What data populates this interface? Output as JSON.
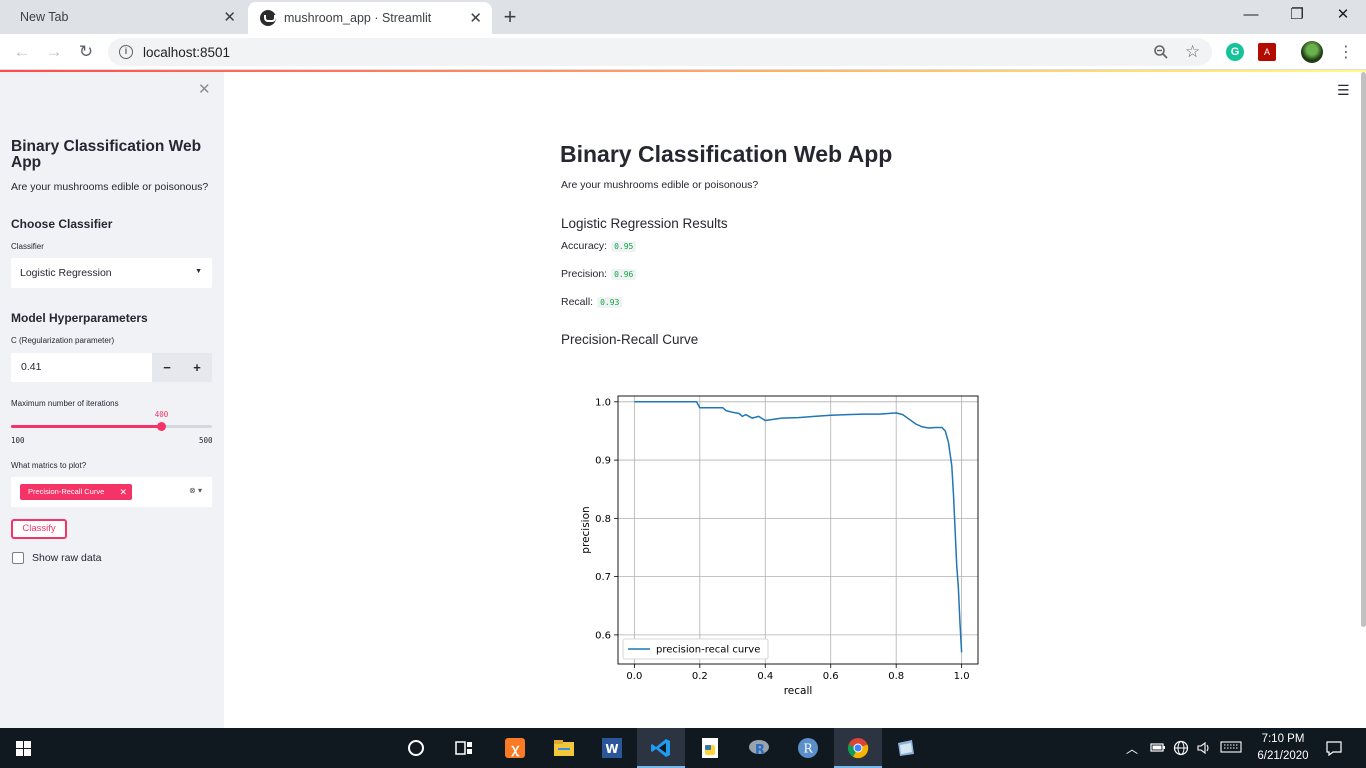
{
  "browser": {
    "tabs": [
      {
        "label": "New Tab",
        "active": false
      },
      {
        "label": "mushroom_app · Streamlit",
        "active": true
      }
    ],
    "url": "localhost:8501",
    "window_controls": {
      "minimize": "—",
      "restore": "❐",
      "close": "✕"
    }
  },
  "sidebar": {
    "close_icon": "✕",
    "title": "Binary Classification Web App",
    "subtitle": "Are your mushrooms edible or poisonous?",
    "choose_classifier_heading": "Choose Classifier",
    "classifier_label": "Classifier",
    "classifier_value": "Logistic Regression",
    "hyperparams_heading": "Model Hyperparameters",
    "c_label": "C (Regularization parameter)",
    "c_value": "0.41",
    "minus": "−",
    "plus": "+",
    "iter_label": "Maximum number of iterations",
    "iter_value": "400",
    "iter_min": "100",
    "iter_max": "500",
    "iter_fraction": 0.75,
    "metrics_label": "What matrics to plot?",
    "metrics_chip": "Precision-Recall Curve",
    "classify_button": "Classify",
    "show_raw_label": "Show raw data"
  },
  "main": {
    "title": "Binary Classification Web App",
    "subtitle": "Are your mushrooms edible or poisonous?",
    "results_heading": "Logistic Regression Results",
    "metrics": [
      {
        "label": "Accuracy:",
        "value": "0.95"
      },
      {
        "label": "Precision:",
        "value": "0.96"
      },
      {
        "label": "Recall:",
        "value": "0.93"
      }
    ],
    "pr_heading": "Precision-Recall Curve"
  },
  "chart_data": {
    "type": "line",
    "title": "",
    "xlabel": "recall",
    "ylabel": "precision",
    "xlim": [
      -0.05,
      1.05
    ],
    "ylim": [
      0.55,
      1.01
    ],
    "xticks": [
      "0.0",
      "0.2",
      "0.4",
      "0.6",
      "0.8",
      "1.0"
    ],
    "yticks": [
      "0.6",
      "0.7",
      "0.8",
      "0.9",
      "1.0"
    ],
    "grid": true,
    "legend": "lower left",
    "color": "#1f77b4",
    "series": [
      {
        "name": "precision-recal curve",
        "x": [
          0.0,
          0.05,
          0.1,
          0.15,
          0.19,
          0.2,
          0.22,
          0.25,
          0.27,
          0.28,
          0.3,
          0.32,
          0.33,
          0.34,
          0.36,
          0.38,
          0.4,
          0.45,
          0.5,
          0.55,
          0.6,
          0.65,
          0.7,
          0.75,
          0.8,
          0.82,
          0.84,
          0.86,
          0.88,
          0.9,
          0.92,
          0.94,
          0.95,
          0.96,
          0.97,
          0.975,
          0.98,
          0.985,
          0.99,
          0.995,
          1.0
        ],
        "y": [
          1.0,
          1.0,
          1.0,
          1.0,
          1.0,
          0.99,
          0.99,
          0.99,
          0.99,
          0.985,
          0.982,
          0.98,
          0.975,
          0.978,
          0.972,
          0.975,
          0.968,
          0.972,
          0.973,
          0.975,
          0.977,
          0.978,
          0.979,
          0.979,
          0.981,
          0.978,
          0.97,
          0.962,
          0.957,
          0.955,
          0.956,
          0.956,
          0.95,
          0.93,
          0.89,
          0.84,
          0.78,
          0.72,
          0.68,
          0.62,
          0.57
        ]
      }
    ]
  },
  "taskbar": {
    "time": "7:10 PM",
    "date": "6/21/2020"
  }
}
